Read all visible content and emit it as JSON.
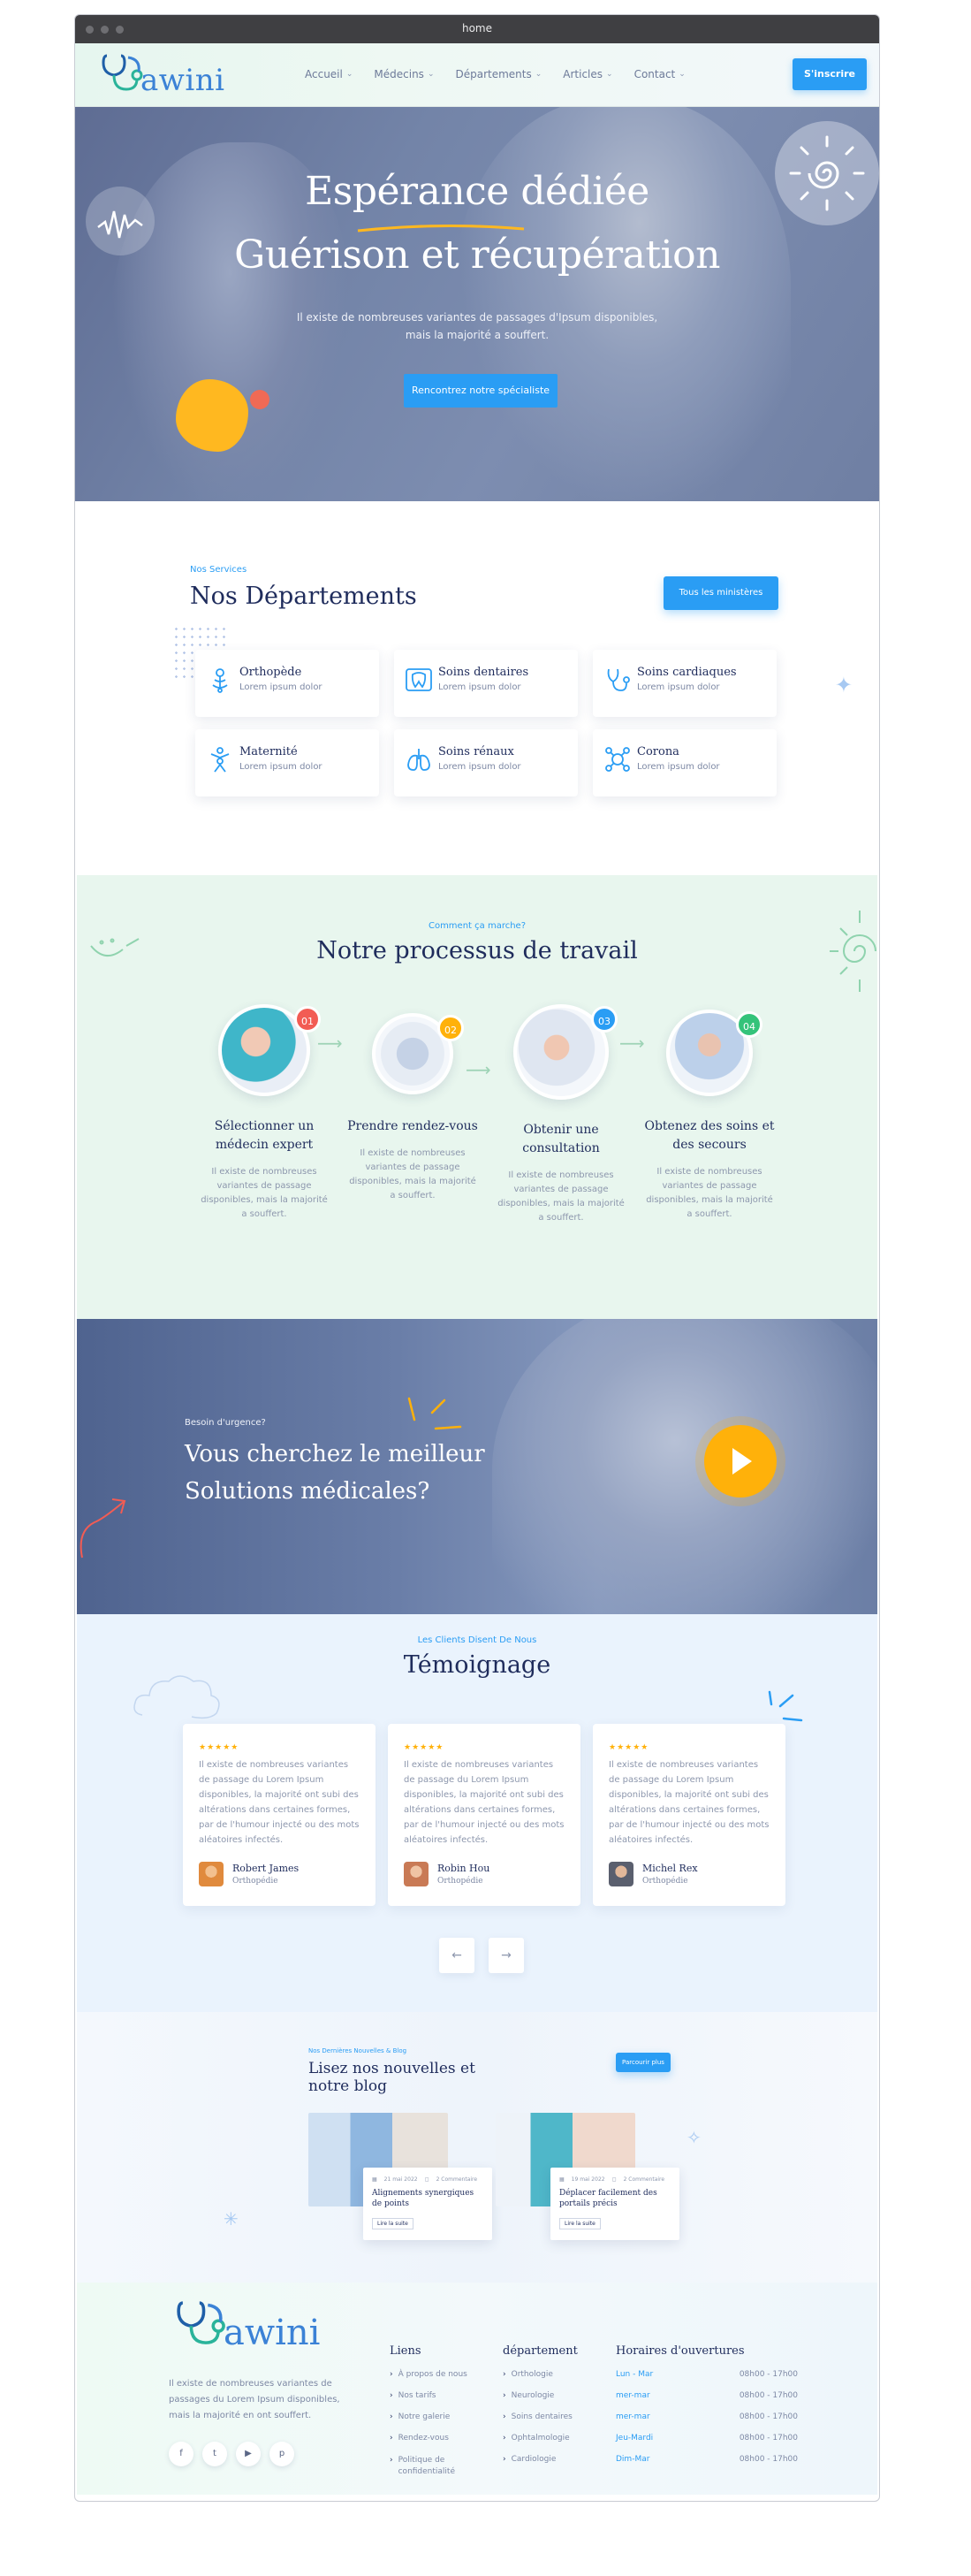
{
  "window": {
    "title": "home"
  },
  "nav": {
    "brand": "awini",
    "menu": [
      {
        "label": "Accueil"
      },
      {
        "label": "Médecins"
      },
      {
        "label": "Départements"
      },
      {
        "label": "Articles"
      },
      {
        "label": "Contact"
      }
    ],
    "signup": "S'inscrire"
  },
  "hero": {
    "line1": "Espérance dédiée",
    "line2": "Guérison et récupération",
    "subtitle_1": "Il existe de nombreuses variantes de passages d'Ipsum disponibles,",
    "subtitle_2": "mais la majorité a souffert.",
    "cta": "Rencontrez notre spécialiste"
  },
  "departments": {
    "eyebrow": "Nos Services",
    "title": "Nos Départements",
    "button": "Tous les ministères",
    "items": [
      {
        "title": "Orthopède",
        "sub": "Lorem ipsum dolor",
        "icon": "bone-icon"
      },
      {
        "title": "Soins dentaires",
        "sub": "Lorem ipsum dolor",
        "icon": "tooth-icon"
      },
      {
        "title": "Soins cardiaques",
        "sub": "Lorem ipsum dolor",
        "icon": "stethoscope-icon"
      },
      {
        "title": "Maternité",
        "sub": "Lorem ipsum dolor",
        "icon": "mother-baby-icon"
      },
      {
        "title": "Soins rénaux",
        "sub": "Lorem ipsum dolor",
        "icon": "lungs-icon"
      },
      {
        "title": "Corona",
        "sub": "Lorem ipsum dolor",
        "icon": "virus-icon"
      }
    ]
  },
  "process": {
    "eyebrow": "Comment ça marche?",
    "title": "Notre processus de travail",
    "steps": [
      {
        "num": "01",
        "title_1": "Sélectionner un",
        "title_2": "médecin expert",
        "desc": "Il existe de nombreuses variantes de passage disponibles, mais la majorité a souffert.",
        "color": "#f25c54"
      },
      {
        "num": "02",
        "title_1": "Prendre rendez-vous",
        "title_2": "",
        "desc": "Il existe de nombreuses variantes de passage disponibles, mais la majorité a souffert.",
        "color": "#ffb10a"
      },
      {
        "num": "03",
        "title_1": "Obtenir une",
        "title_2": "consultation",
        "desc": "Il existe de nombreuses variantes de passage disponibles, mais la majorité a souffert.",
        "color": "#2a9df4"
      },
      {
        "num": "04",
        "title_1": "Obtenez des soins et",
        "title_2": "des secours",
        "desc": "Il existe de nombreuses variantes de passage disponibles, mais la majorité a souffert.",
        "color": "#34c37a"
      }
    ]
  },
  "emergency": {
    "eyebrow": "Besoin d'urgence?",
    "line1": "Vous cherchez le meilleur",
    "line2": "Solutions médicales?"
  },
  "testimonials": {
    "eyebrow": "Les Clients Disent De Nous",
    "title": "Témoignage",
    "stars": "★★★★★",
    "items": [
      {
        "text": "Il existe de nombreuses variantes de passage du Lorem Ipsum disponibles, la majorité ont subi des altérations dans certaines formes, par de l'humour injecté ou des mots aléatoires infectés.",
        "name": "Robert James",
        "role": "Orthopédie"
      },
      {
        "text": "Il existe de nombreuses variantes de passage du Lorem Ipsum disponibles, la majorité ont subi des altérations dans certaines formes, par de l'humour injecté ou des mots aléatoires infectés.",
        "name": "Robin Hou",
        "role": "Orthopédie"
      },
      {
        "text": "Il existe de nombreuses variantes de passage du Lorem Ipsum disponibles, la majorité ont subi des altérations dans certaines formes, par de l'humour injecté ou des mots aléatoires infectés.",
        "name": "Michel Rex",
        "role": "Orthopédie"
      }
    ],
    "prev": "←",
    "next": "→"
  },
  "blog": {
    "eyebrow": "Nos Dernières Nouvelles & Blog",
    "title": "Lisez nos nouvelles et notre blog",
    "button": "Parcourir plus",
    "posts": [
      {
        "date": "21 mai 2022",
        "comments": "2 Commentaire",
        "title": "Alignements synergiques de points",
        "more": "Lire la suite"
      },
      {
        "date": "19 mai 2022",
        "comments": "2 Commentaire",
        "title": "Déplacer facilement des portails précis",
        "more": "Lire la suite"
      }
    ]
  },
  "footer": {
    "brand": "awini",
    "text": "Il existe de nombreuses variantes de passages du Lorem Ipsum disponibles, mais la majorité en ont souffert.",
    "social": [
      "f",
      "t",
      "▶",
      "p"
    ],
    "links_title": "Liens",
    "links": [
      "À propos de nous",
      "Nos tarifs",
      "Notre galerie",
      "Rendez-vous",
      "Politique de confidentialité"
    ],
    "dept_title": "département",
    "depts": [
      "Orthologie",
      "Neurologie",
      "Soins dentaires",
      "Ophtalmologie",
      "Cardiologie"
    ],
    "hours_title": "Horaires d'ouvertures",
    "hours": [
      {
        "day": "Lun - Mar",
        "time": "08h00 - 17h00"
      },
      {
        "day": "mer-mar",
        "time": "08h00 - 17h00"
      },
      {
        "day": "mer-mar",
        "time": "08h00 - 17h00"
      },
      {
        "day": "Jeu-Mardi",
        "time": "08h00 - 17h00"
      },
      {
        "day": "Dim-Mar",
        "time": "08h00 - 17h00"
      }
    ]
  },
  "colors": {
    "primary": "#2a9df4",
    "navy": "#1f2c5c",
    "accent": "#ffb10a"
  }
}
